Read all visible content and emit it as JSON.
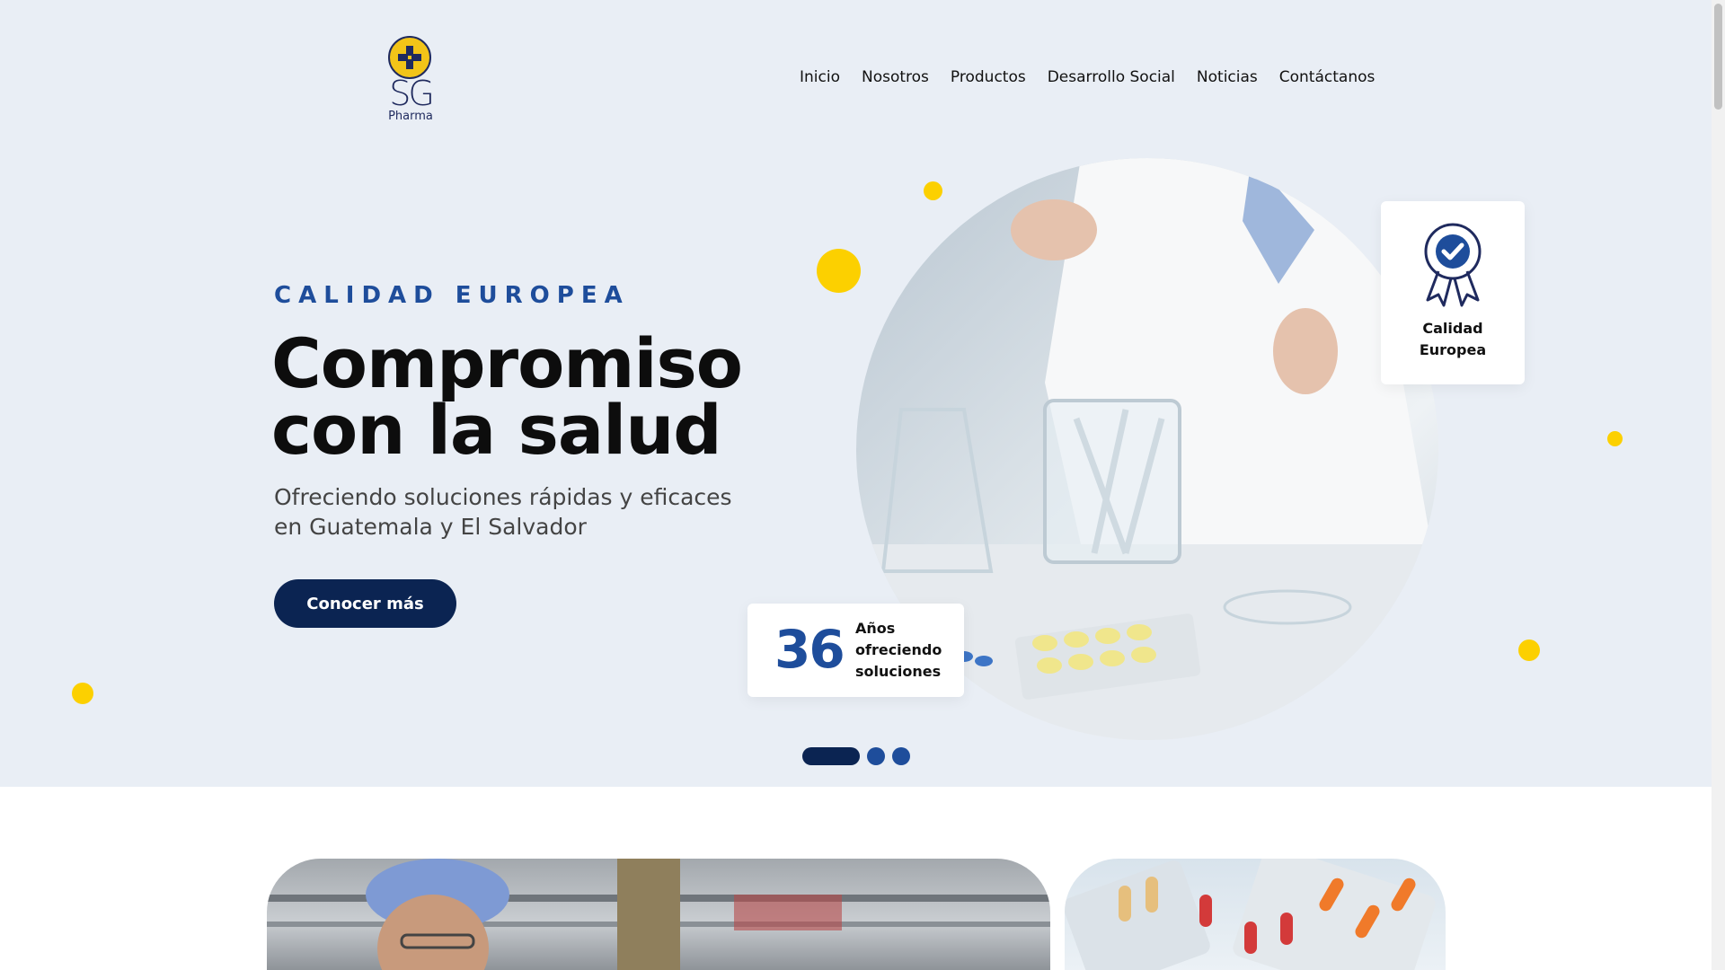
{
  "brand": {
    "logo_text": "SG",
    "logo_sub": "Pharma",
    "primary_color": "#0b2452",
    "accent_color": "#fcd000",
    "blue": "#1e4d9b"
  },
  "nav": {
    "items": [
      "Inicio",
      "Nosotros",
      "Productos",
      "Desarrollo Social",
      "Noticias",
      "Contáctanos"
    ]
  },
  "hero": {
    "eyebrow": "CALIDAD EUROPEA",
    "headline_line1": "Compromiso",
    "headline_line2": "con la salud",
    "subtitle": "Ofreciendo soluciones rápidas y eficaces en Guatemala y El Salvador",
    "cta_label": "Conocer más",
    "years_number": "36",
    "years_text_line1": "Años",
    "years_text_line2": "ofreciendo",
    "years_text_line3": "soluciones",
    "quality_line1": "Calidad",
    "quality_line2": "Europea",
    "quality_icon": "award-ribbon-icon",
    "slides_total": 3,
    "slide_active": 1
  }
}
